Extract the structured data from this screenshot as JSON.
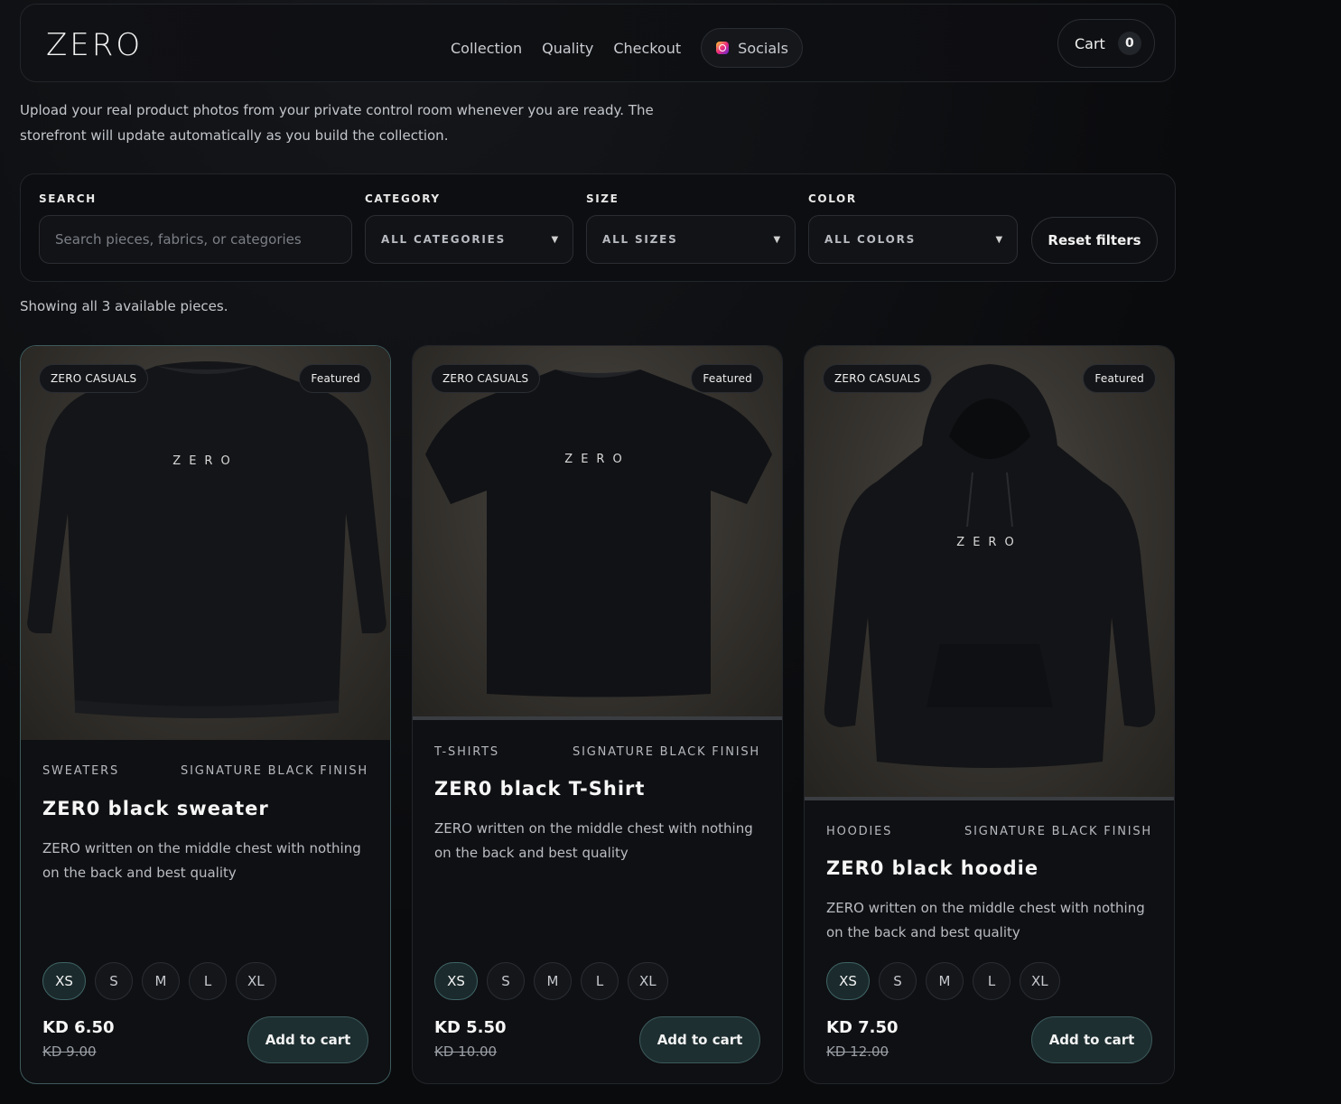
{
  "header": {
    "brand": "ZERO",
    "nav": [
      "Collection",
      "Quality",
      "Checkout"
    ],
    "socials_label": "Socials",
    "cart_label": "Cart",
    "cart_count": "0"
  },
  "intro": "Upload your real product photos from your private control room whenever you are ready. The storefront will update automatically as you build the collection.",
  "filters": {
    "search_label": "SEARCH",
    "search_placeholder": "Search pieces, fabrics, or categories",
    "category_label": "CATEGORY",
    "category_value": "ALL CATEGORIES",
    "size_label": "SIZE",
    "size_value": "ALL SIZES",
    "color_label": "COLOR",
    "color_value": "ALL COLORS",
    "reset_label": "Reset filters"
  },
  "showing": "Showing all 3 available pieces.",
  "products": [
    {
      "brand_tag": "ZERO CASUALS",
      "featured": "Featured",
      "print": "ZERO",
      "category": "SWEATERS",
      "finish": "SIGNATURE BLACK FINISH",
      "name": "ZER0 black sweater",
      "description": "ZERO written on the middle chest with nothing on the back and best quality",
      "sizes": [
        "XS",
        "S",
        "M",
        "L",
        "XL"
      ],
      "selected_size": "XS",
      "price": "KD 6.50",
      "old_price": "KD 9.00",
      "add_label": "Add to cart"
    },
    {
      "brand_tag": "ZERO CASUALS",
      "featured": "Featured",
      "print": "ZERO",
      "category": "T-SHIRTS",
      "finish": "SIGNATURE BLACK FINISH",
      "name": "ZER0 black T-Shirt",
      "description": "ZERO written on the middle chest with nothing on the back and best quality",
      "sizes": [
        "XS",
        "S",
        "M",
        "L",
        "XL"
      ],
      "selected_size": "XS",
      "price": "KD 5.50",
      "old_price": "KD 10.00",
      "add_label": "Add to cart"
    },
    {
      "brand_tag": "ZERO CASUALS",
      "featured": "Featured",
      "print": "ZERO",
      "category": "HOODIES",
      "finish": "SIGNATURE BLACK FINISH",
      "name": "ZER0 black hoodie",
      "description": "ZERO written on the middle chest with nothing on the back and best quality",
      "sizes": [
        "XS",
        "S",
        "M",
        "L",
        "XL"
      ],
      "selected_size": "XS",
      "price": "KD 7.50",
      "old_price": "KD 12.00",
      "add_label": "Add to cart"
    }
  ]
}
